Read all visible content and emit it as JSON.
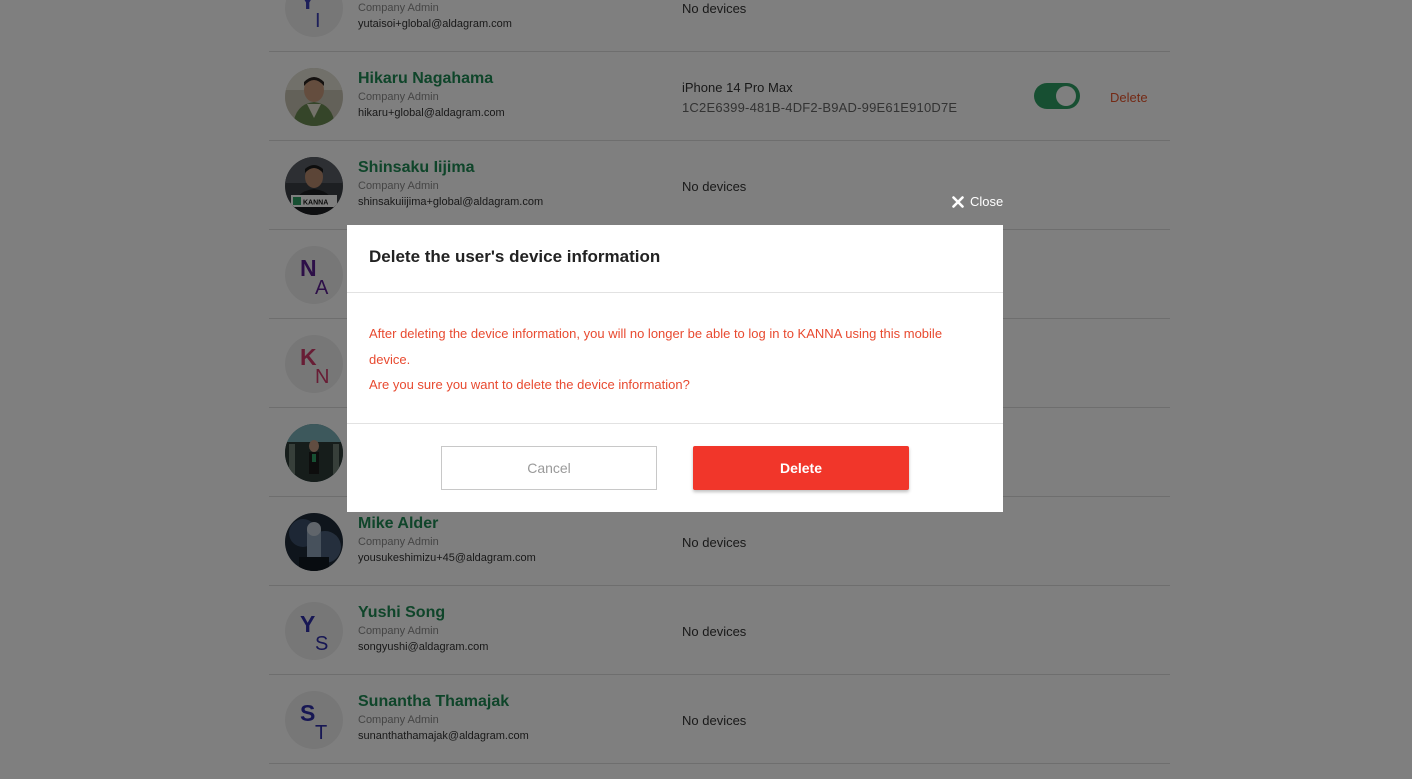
{
  "users": [
    {
      "name": "",
      "role": "Company Admin",
      "email": "yutaisoi+global@aldagram.com",
      "device": "No devices",
      "initial1": "Y",
      "initial2": "I",
      "initial_color": "#3b3fb5"
    },
    {
      "name": "Hikaru Nagahama",
      "role": "Company Admin",
      "email": "hikaru+global@aldagram.com",
      "device_name": "iPhone 14 Pro Max",
      "device_id": "1C2E6399-481B-4DF2-B9AD-99E61E910D7E",
      "toggle_on": true,
      "delete_label": "Delete",
      "avatar": "photo"
    },
    {
      "name": "Shinsaku Iijima",
      "role": "Company Admin",
      "email": "shinsakuiijima+global@aldagram.com",
      "device": "No devices",
      "avatar": "photo",
      "avatar_text": "KANNA"
    },
    {
      "name": "",
      "role": "",
      "email": "",
      "device": "",
      "initial1": "N",
      "initial2": "A",
      "initial_color": "#5a1e91"
    },
    {
      "name": "",
      "role": "",
      "email": "",
      "device": "",
      "initial1": "K",
      "initial2": "N",
      "initial_color": "#d03a6a"
    },
    {
      "name": "",
      "role": "",
      "email": "",
      "device": "",
      "avatar": "photo"
    },
    {
      "name": "Mike Alder",
      "role": "Company Admin",
      "email": "yousukeshimizu+45@aldagram.com",
      "device": "No devices",
      "avatar": "photo"
    },
    {
      "name": "Yushi Song",
      "role": "Company Admin",
      "email": "songyushi@aldagram.com",
      "device": "No devices",
      "initial1": "Y",
      "initial2": "S",
      "initial_color": "#2f2fa8"
    },
    {
      "name": "Sunantha Thamajak",
      "role": "Company Admin",
      "email": "sunanthathamajak@aldagram.com",
      "device": "No devices",
      "initial1": "S",
      "initial2": "T",
      "initial_color": "#2f2fa8"
    }
  ],
  "modal": {
    "close_label": "Close",
    "title": "Delete the user's device information",
    "message_line1": "After deleting the device information, you will no longer be able to log in to KANNA using this mobile device.",
    "message_line2": "Are you sure you want to delete the device information?",
    "cancel_label": "Cancel",
    "delete_label": "Delete"
  },
  "colors": {
    "accent_green": "#1e8a54",
    "danger": "#f1362a",
    "warning_text": "#e84a30"
  }
}
